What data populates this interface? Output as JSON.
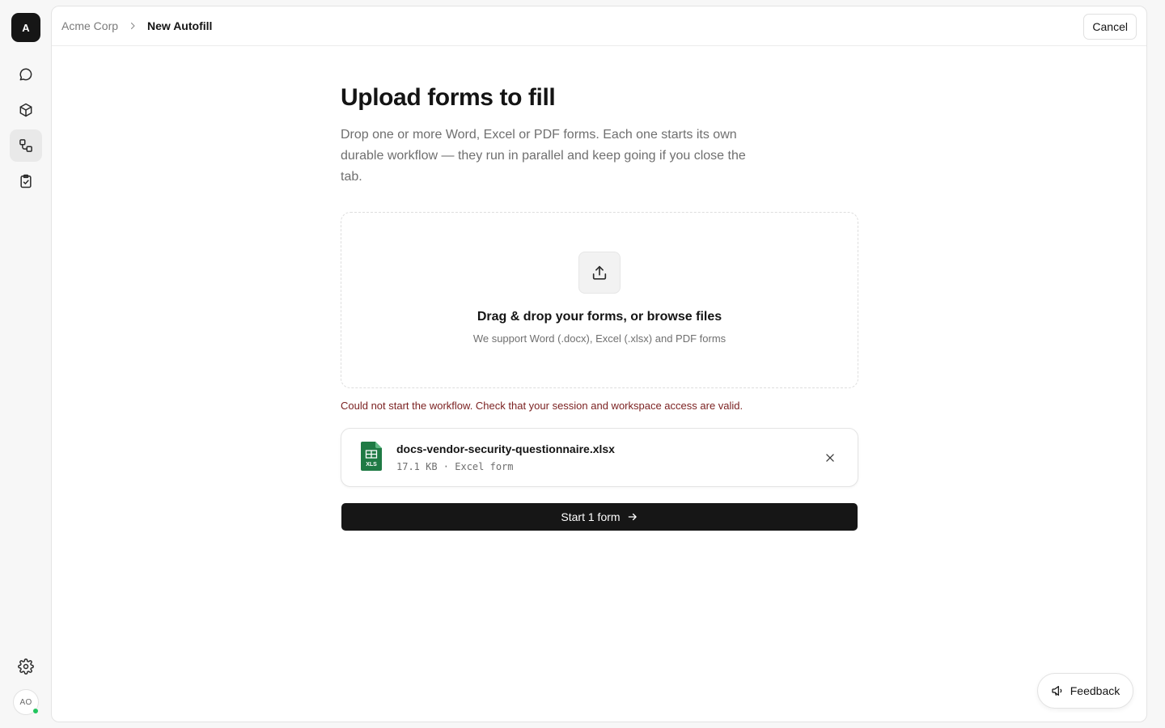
{
  "workspace": {
    "initial": "A"
  },
  "rail": {
    "items": [
      {
        "name": "chat-icon"
      },
      {
        "name": "cube-icon"
      },
      {
        "name": "workflow-icon",
        "active": true
      },
      {
        "name": "clipboard-check-icon"
      }
    ],
    "settings_icon": "gear-icon",
    "user_initials": "AO",
    "presence_color": "#22c55e"
  },
  "breadcrumb": {
    "root": "Acme Corp",
    "current": "New Autofill"
  },
  "header": {
    "cancel_label": "Cancel"
  },
  "page": {
    "title": "Upload forms to fill",
    "subtitle": "Drop one or more Word, Excel or PDF forms. Each one starts its own durable workflow — they run in parallel and keep going if you close the tab."
  },
  "dropzone": {
    "title": "Drag & drop your forms, or browse files",
    "subtitle": "We support Word (.docx), Excel (.xlsx) and PDF forms"
  },
  "error": {
    "message": "Could not start the workflow. Check that your session and workspace access are valid."
  },
  "file": {
    "name": "docs-vendor-security-questionnaire.xlsx",
    "meta": "17.1 KB · Excel form",
    "icon_label": "XLS",
    "icon_color": "#1f7a44"
  },
  "actions": {
    "start_label": "Start 1 form"
  },
  "feedback": {
    "label": "Feedback"
  },
  "colors": {
    "primary": "#161616",
    "error": "#7a1f1f"
  }
}
